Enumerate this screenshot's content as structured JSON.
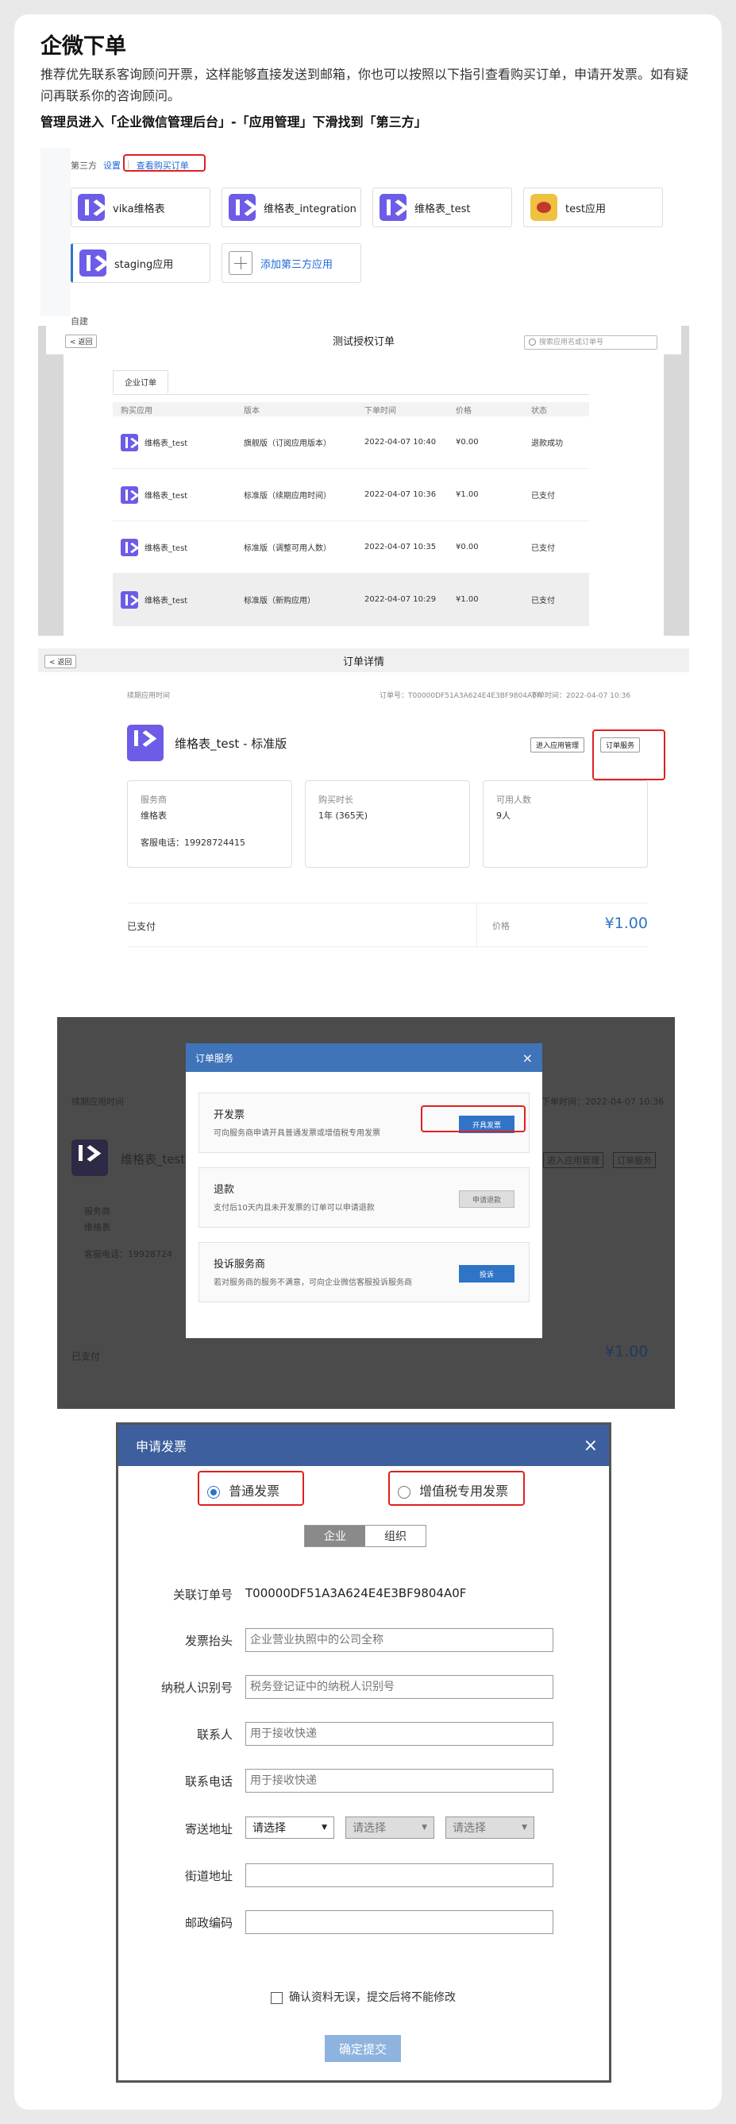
{
  "page": {
    "title": "企微下单",
    "intro": "推荐优先联系客询顾问开票，这样能够直接发送到邮箱，你也可以按照以下指引查看购买订单，申请开发票。如有疑问再联系你的咨询顾问。",
    "step": "管理员进入「企业微信管理后台」-「应用管理」下滑找到「第三方」"
  },
  "apps_panel": {
    "tabs": [
      "第三方",
      "设置",
      "查看购买订单"
    ],
    "apps": [
      {
        "name": "vika维格表",
        "icon": "vika-logo-icon"
      },
      {
        "name": "维格表_integration",
        "icon": "vika-logo-icon"
      },
      {
        "name": "维格表_test",
        "icon": "vika-logo-icon"
      },
      {
        "name": "test应用",
        "icon": "pig-app-icon"
      },
      {
        "name": "staging应用",
        "icon": "vika-logo-icon"
      }
    ],
    "add_label": "添加第三方应用",
    "footer": "自建"
  },
  "orders": {
    "back": "< 返回",
    "title": "测试授权订单",
    "search_placeholder": "搜索应用名或订单号",
    "tab": "企业订单",
    "columns": [
      "购买应用",
      "版本",
      "下单时间",
      "价格",
      "状态"
    ],
    "rows": [
      {
        "app": "维格表_test",
        "version": "旗舰版（订阅应用版本）",
        "time": "2022-04-07 10:40",
        "price": "¥0.00",
        "status": "退款成功"
      },
      {
        "app": "维格表_test",
        "version": "标准版（续期应用时间）",
        "time": "2022-04-07 10:36",
        "price": "¥1.00",
        "status": "已支付"
      },
      {
        "app": "维格表_test",
        "version": "标准版（调整可用人数）",
        "time": "2022-04-07 10:35",
        "price": "¥0.00",
        "status": "已支付"
      },
      {
        "app": "维格表_test",
        "version": "标准版（新购应用）",
        "time": "2022-04-07 10:29",
        "price": "¥1.00",
        "status": "已支付"
      }
    ]
  },
  "detail": {
    "back": "< 返回",
    "title": "订单详情",
    "left_note": "续期应用时间",
    "order_no": "订单号：T00000DF51A3A624E4E3BF9804A0F",
    "order_time": "下单时间：2022-04-07 10:36",
    "product": "维格表_test - 标准版",
    "manage_btn": "进入应用管理",
    "service_btn": "订单服务",
    "provider_label": "服务商",
    "provider": "维格表",
    "phone": "客服电话：19928724415",
    "duration_label": "购买时长",
    "duration": "1年 (365天)",
    "users_label": "可用人数",
    "users": "9人",
    "paid": "已支付",
    "price_label": "价格",
    "price": "¥1.00"
  },
  "service_modal": {
    "title": "订单服务",
    "close": "×",
    "items": [
      {
        "title": "开发票",
        "desc": "可向服务商申请开具普通发票或增值税专用发票",
        "btn": "开具发票"
      },
      {
        "title": "退款",
        "desc": "支付后10天内且未开发票的订单可以申请退款",
        "btn": "申请退款"
      },
      {
        "title": "投诉服务商",
        "desc": "若对服务商的服务不满意，可向企业微信客服投诉服务商",
        "btn": "投诉"
      }
    ],
    "bg_left": "续期应用时间",
    "bg_right": "下单时间：2022-04-07 10:36",
    "bg_product": "维格表_test",
    "bg_provider_label": "服务商",
    "bg_provider": "维格表",
    "bg_phone": "客服电话：19928724",
    "bg_manage": "进入应用管理",
    "bg_service": "订单服务",
    "bg_paid": "已支付",
    "bg_price": "¥1.00"
  },
  "invoice": {
    "title": "申请发票",
    "close": "×",
    "type_normal": "普通发票",
    "type_vat": "增值税专用发票",
    "seg_company": "企业",
    "seg_org": "组织",
    "order_label": "关联订单号",
    "order_value": "T00000DF51A3A624E4E3BF9804A0F",
    "header_label": "发票抬头",
    "header_ph": "企业营业执照中的公司全称",
    "tax_label": "纳税人识别号",
    "tax_ph": "税务登记证中的纳税人识别号",
    "contact_label": "联系人",
    "contact_ph": "用于接收快递",
    "phone_label": "联系电话",
    "phone_ph": "用于接收快递",
    "addr_label": "寄送地址",
    "select": "请选择",
    "street_label": "街道地址",
    "zip_label": "邮政编码",
    "confirm": "确认资料无误，提交后将不能修改",
    "submit": "确定提交"
  },
  "colors": {
    "accent": "#2f74c6",
    "highlight": "#e02020",
    "modal_header": "#3d5f9d",
    "vika": "#6c5ce7"
  }
}
